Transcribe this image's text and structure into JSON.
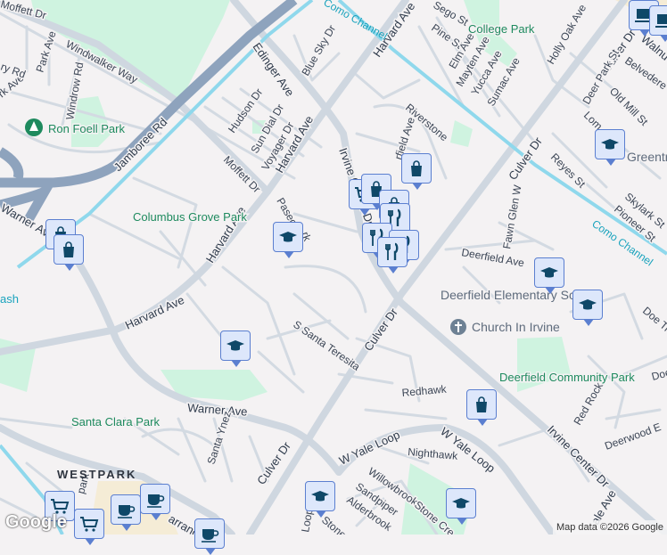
{
  "roads": {
    "jamboree": "Jamboree Rd",
    "edinger": "Edinger Ave",
    "harvard1": "Harvard Ave",
    "harvard2": "Harvard Ave",
    "harvard3": "Harvard Ave",
    "harvard4": "Harvard Ave",
    "irvine_center1": "Irvine Center Dr",
    "irvine_center2": "Irvine Center Dr",
    "culver1": "Culver Dr",
    "culver2": "Culver Dr",
    "culver3": "Culver Dr",
    "culver4": "Culver Dr",
    "warner1": "Warner Ave",
    "warner2": "Warner Ave",
    "moffett1": "Moffett Dr",
    "moffett2": "Moffett Dr",
    "windwalker": "Windwalker Way",
    "windrow": "Windrow Rd",
    "park_ave": "Park Ave",
    "park_ave2": "rk Ave",
    "ry_rd": "ry Rd",
    "hudson": "Hudson Dr",
    "sun_dial": "Sun Dial Dr",
    "voyager": "Voyager Dr",
    "blue_sky": "Blue Sky Dr",
    "sego": "Sego St",
    "pine": "Pine St",
    "elm": "Elm Ave",
    "mayten": "Mayten Ave",
    "yucca": "Yucca Ave",
    "sumac": "Sumac Ave",
    "holly_oak": "Holly Oak Ave",
    "walnut": "Walnu",
    "belvedere": "Belvedere St",
    "deer_park": "Deer Park St",
    "old_mill": "Old Mill St",
    "lom": "Lom",
    "reyes": "Reyes St",
    "skylark": "Skylark St",
    "pioneer": "Pioneer St",
    "riverstone": "Riverstone",
    "deerfield_ave": "Deerfield Ave",
    "deerfield_ave2": "rfield Ave",
    "fawn_glen": "Fawn Glen W",
    "paseo": "Paseo",
    "paseo2": "rk",
    "santa_teresita": "S Santa Teresita",
    "santa_ynez": "Santa Ynez",
    "redhawk": "Redhawk",
    "yale1": "W Yale Loop",
    "yale2": "W Yale Loop",
    "nighthawk": "Nighthawk",
    "willowbrook": "Willowbrook",
    "sandpiper": "Sandpiper",
    "alderbrook": "Alderbrook",
    "stone_creek": "Stone Cre",
    "stone_creek2": "Stone C",
    "red_rock": "Red Rock",
    "deerwood": "Deerwood E",
    "doe_trail": "Doe Tra",
    "doe2": "Doe",
    "dale": "ale Ave",
    "yale_loop_s": "Loop",
    "westpark_rd": "park",
    "barranca": "arranc",
    "como1": "Como Channel",
    "como2": "Como Channel",
    "ash": "ash"
  },
  "parks": {
    "ron_foell": "Ron Foell Park",
    "columbus_grove": "Columbus Grove Park",
    "college": "College Park",
    "santa_clara": "Santa Clara Park",
    "deerfield_community": "Deerfield Community Park"
  },
  "pois": {
    "deerfield_school": "Deerfield Elementary School",
    "greentree": "Greentree Elementary",
    "church": "Church In Irvine"
  },
  "district": "WESTPARK",
  "markers": [
    "shopping",
    "shopping",
    "school",
    "school",
    "school",
    "school",
    "school",
    "school",
    "school",
    "shopping",
    "shopping",
    "grocery",
    "shopping",
    "shopping",
    "restaurant",
    "restaurant",
    "restaurant",
    "restaurant",
    "grocery",
    "grocery",
    "cafe",
    "cafe",
    "cafe",
    "electronics",
    "electronics"
  ],
  "logo": "Google",
  "attribution": "Map data ©2026 Google",
  "colors": {
    "marker_bg": "#dde7fb",
    "marker_border": "#5b7fd0",
    "icon": "#0f4868",
    "park": "#cdf1dd",
    "freeway": "#8ea3bd",
    "channel": "#8fd8ec"
  }
}
